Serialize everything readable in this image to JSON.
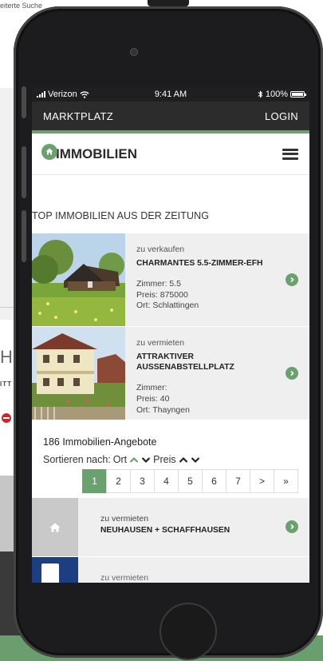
{
  "background": {
    "search_link": "eiterte Suche",
    "logo_letter": "H",
    "logo_small": "ITT"
  },
  "statusbar": {
    "carrier": "Verizon",
    "time": "9:41 AM",
    "battery": "100%"
  },
  "nav": {
    "left": "MARKTPLATZ",
    "right": "LOGIN"
  },
  "brand": {
    "name": "IMMOBILIEN",
    "accent": "#6aa16f"
  },
  "section_title": "TOP IMMOBILIEN AUS DER ZEITUNG",
  "listings": [
    {
      "kind": "zu verkaufen",
      "title": "CHARMANTES 5.5-ZIMMER-EFH",
      "rooms": "Zimmer: 5.5",
      "price": "Preis: 875000",
      "place": "Ort: Schlattingen"
    },
    {
      "kind": "zu vermieten",
      "title_line1": "ATTRAKTIVER",
      "title_line2": "AUSSENABSTELLPLATZ",
      "rooms": "Zimmer:",
      "price": "Preis: 40",
      "place": "Ort: Thayngen"
    }
  ],
  "results": {
    "count": "186 Immobilien-Angebote",
    "sort_label": "Sortieren nach:",
    "sort_ort": "Ort",
    "sort_preis": "Preis"
  },
  "pagination": [
    "1",
    "2",
    "3",
    "4",
    "5",
    "6",
    "7",
    ">",
    "»"
  ],
  "results_list": [
    {
      "kind": "zu vermieten",
      "title": "NEUHAUSEN + SCHAFFHAUSEN"
    },
    {
      "kind": "zu vermieten"
    }
  ]
}
